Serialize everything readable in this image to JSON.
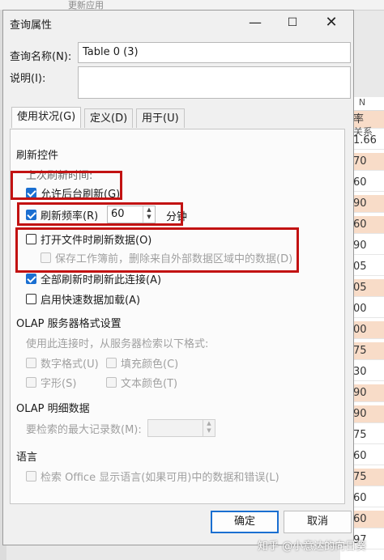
{
  "background": {
    "ribbon_ghost": "更新应用",
    "column_header": "N",
    "right_tab_label": "关系",
    "sheet_cells": [
      "率",
      "1.66",
      "70",
      "60",
      "90",
      "60",
      "90",
      "05",
      "05",
      "00",
      "00",
      "75",
      "30",
      "90",
      "90",
      "75",
      "60",
      "75",
      "60",
      "60",
      "97"
    ]
  },
  "dialog": {
    "title": "查询属性",
    "window_controls": {
      "minimize": "—",
      "maximize": "☐",
      "close": "✕"
    },
    "query_name_label": "查询名称(N):",
    "query_name_value": "Table 0 (3)",
    "description_label": "说明(I):",
    "description_value": "",
    "tabs": [
      {
        "label": "使用状况(G)",
        "active": true
      },
      {
        "label": "定义(D)",
        "active": false
      },
      {
        "label": "用于(U)",
        "active": false
      }
    ],
    "refresh": {
      "section_title": "刷新控件",
      "last_refresh_label": "上次刷新时间:",
      "background_refresh": {
        "label": "允许后台刷新(G)",
        "checked": true
      },
      "refresh_every": {
        "label": "刷新频率(R)",
        "checked": true,
        "value": "60",
        "unit": "分钟"
      },
      "refresh_on_open": {
        "label": "打开文件时刷新数据(O)",
        "checked": false
      },
      "remove_data": {
        "label": "保存工作簿前，删除来自外部数据区域中的数据(D)",
        "checked": false,
        "disabled": true
      },
      "refresh_all": {
        "label": "全部刷新时刷新此连接(A)",
        "checked": true
      },
      "fast_load": {
        "label": "启用快速数据加载(A)",
        "checked": false
      }
    },
    "olap_format": {
      "section_title": "OLAP 服务器格式设置",
      "hint": "使用此连接时，从服务器检索以下格式:",
      "number_format": "数字格式(U)",
      "fill_color": "填充颜色(C)",
      "font_style": "字形(S)",
      "text_color": "文本颜色(T)"
    },
    "olap_drill": {
      "section_title": "OLAP 明细数据",
      "max_records_label": "要检索的最大记录数(M):",
      "max_records_value": ""
    },
    "language": {
      "section_title": "语言",
      "office_language": "检索 Office 显示语言(如果可用)中的数据和错误(L)"
    },
    "buttons": {
      "ok": "确定",
      "cancel": "取消"
    }
  },
  "watermark": "知乎 @小意达的向日葵",
  "colors": {
    "accent": "#1a6fd1",
    "highlight_box": "#c21212",
    "peach_cell": "#f8dcc8"
  }
}
